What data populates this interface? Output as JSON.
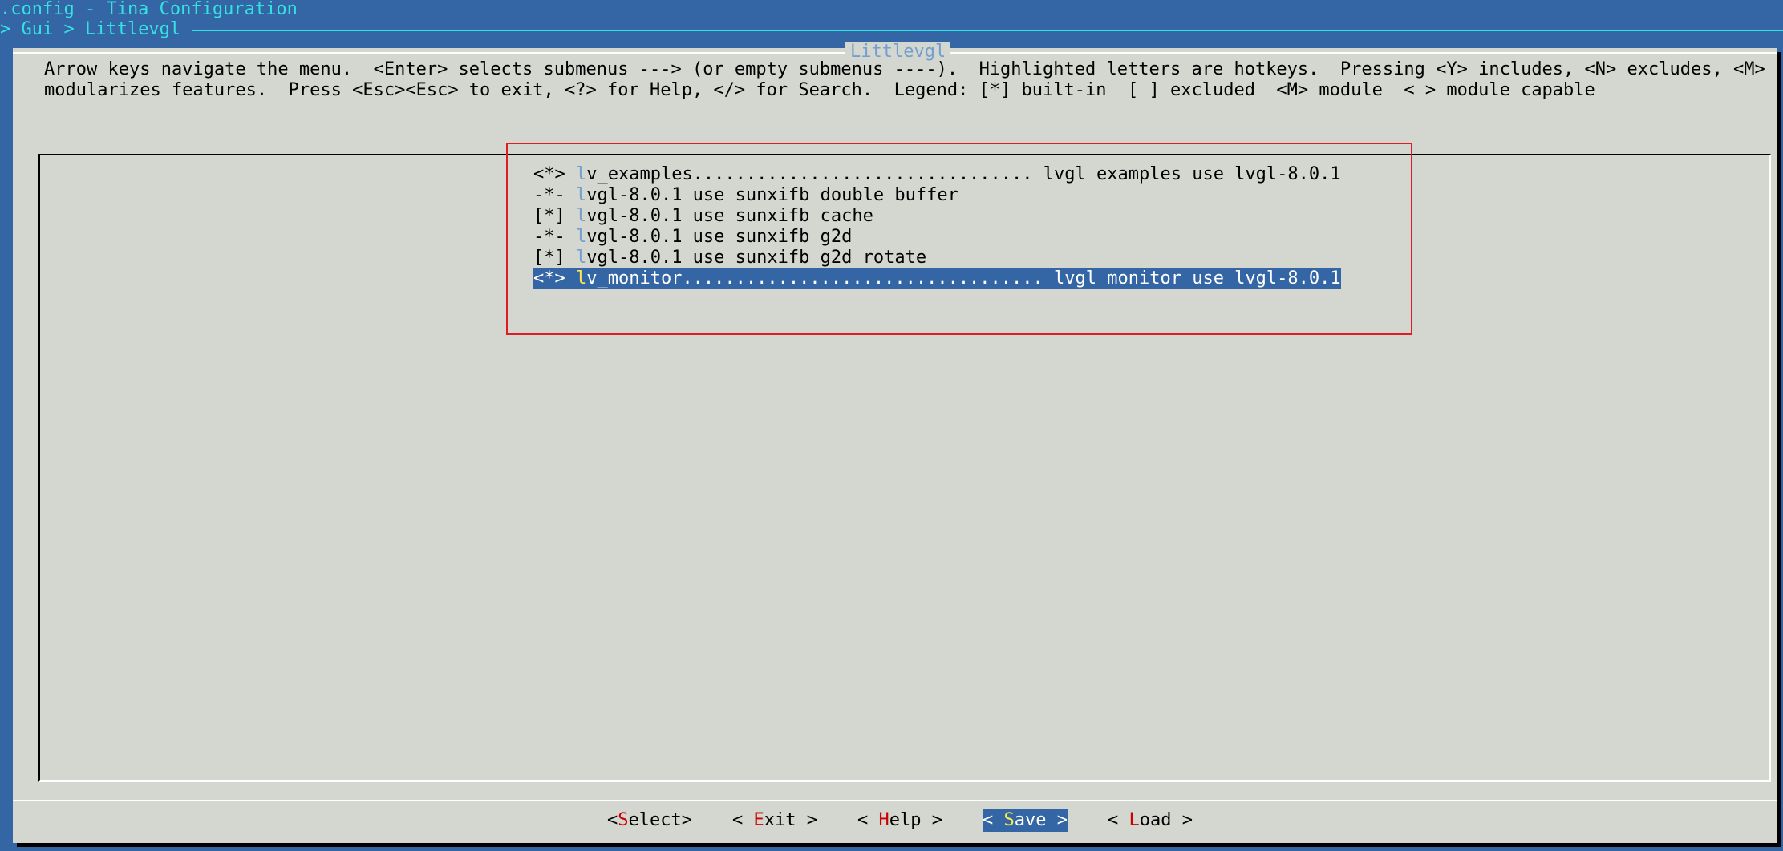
{
  "window": {
    "title": ".config - Tina Configuration",
    "breadcrumb": "> Gui > Littlevgl"
  },
  "dialog": {
    "title": "Littlevgl",
    "help_line_1": "Arrow keys navigate the menu.  <Enter> selects submenus ---> (or empty submenus ----).  Highlighted letters are hotkeys.  Pressing <Y> includes, <N> excludes, <M>",
    "help_line_2": "modularizes features.  Press <Esc><Esc> to exit, <?> for Help, </> for Search.  Legend: [*] built-in  [ ] excluded  <M> module  < > module capable"
  },
  "menu": {
    "items": [
      {
        "prefix": "<*> ",
        "hotkey": "l",
        "rest": "v_examples................................ lvgl examples use lvgl-8.0.1",
        "selected": false
      },
      {
        "prefix": "-*- ",
        "hotkey": "l",
        "rest": "vgl-8.0.1 use sunxifb double buffer",
        "selected": false
      },
      {
        "prefix": "[*] ",
        "hotkey": "l",
        "rest": "vgl-8.0.1 use sunxifb cache",
        "selected": false
      },
      {
        "prefix": "-*- ",
        "hotkey": "l",
        "rest": "vgl-8.0.1 use sunxifb g2d",
        "selected": false
      },
      {
        "prefix": "[*] ",
        "hotkey": "l",
        "rest": "vgl-8.0.1 use sunxifb g2d rotate",
        "selected": false
      },
      {
        "prefix": "<*> ",
        "hotkey": "l",
        "rest": "v_monitor.................................. lvgl monitor use lvgl-8.0.1",
        "selected": true
      }
    ]
  },
  "buttons": {
    "select": {
      "pre": "<",
      "hot": "S",
      "post": "elect>"
    },
    "exit": {
      "pre": "< ",
      "hot": "E",
      "post": "xit >"
    },
    "help": {
      "pre": "< ",
      "hot": "H",
      "post": "elp >"
    },
    "save": {
      "pre": "< ",
      "hot": "S",
      "post": "ave >"
    },
    "load": {
      "pre": "< ",
      "hot": "L",
      "post": "oad >"
    }
  },
  "colors": {
    "background": "#3465a4",
    "dialog": "#d3d7cf",
    "title_text": "#34e2e2",
    "hotkey_menu": "#729fcf",
    "hotkey_button": "#cc0000",
    "selected_hotkey": "#fce94f",
    "annotation_box": "#e01b24"
  }
}
